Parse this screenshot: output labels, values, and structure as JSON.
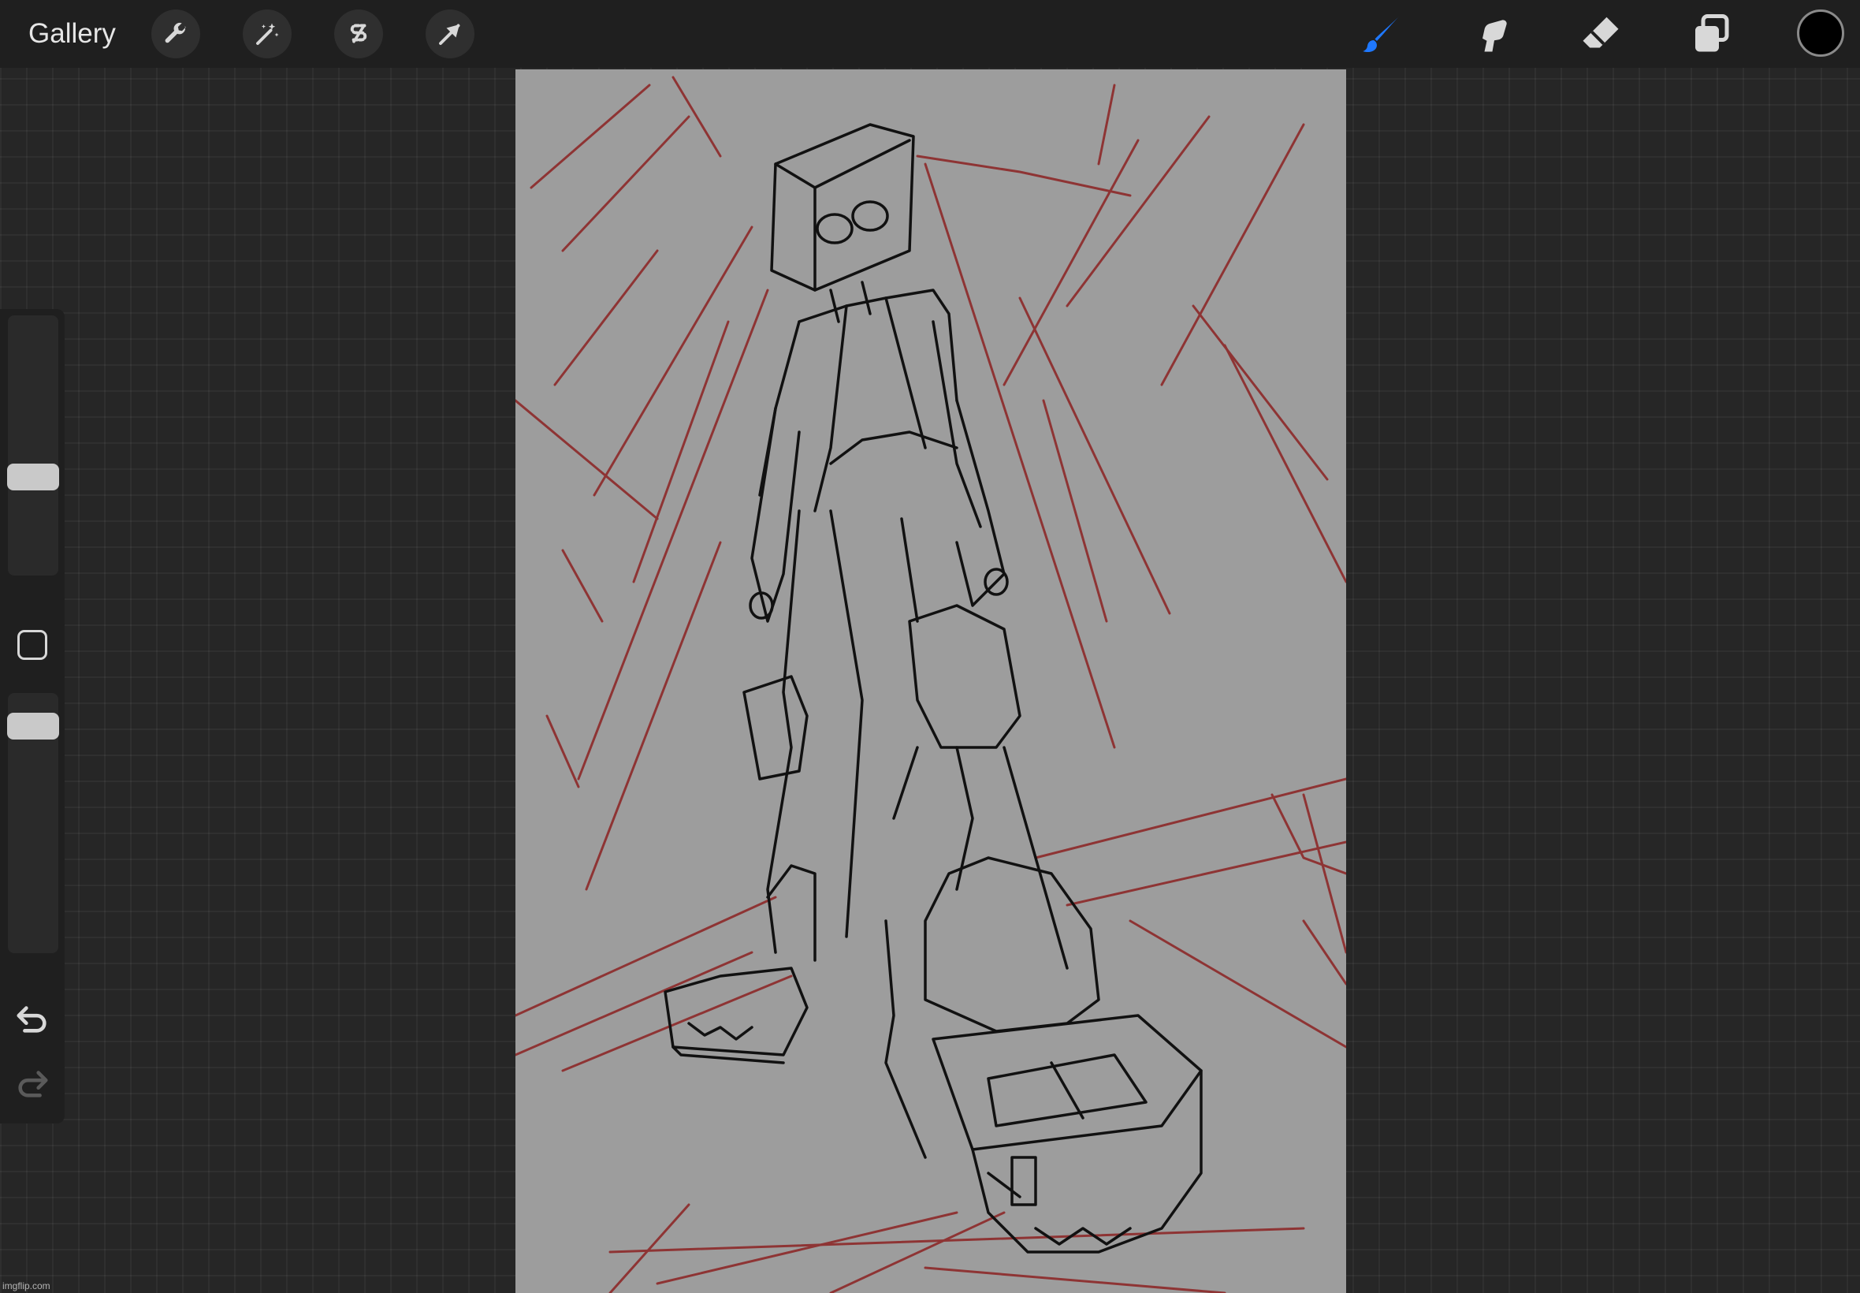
{
  "topbar": {
    "gallery_label": "Gallery",
    "left_tools": [
      "wrench-icon",
      "magic-wand-icon",
      "selection-s-icon",
      "transform-arrow-icon"
    ],
    "right_tools": [
      "brush-icon",
      "smudge-icon",
      "eraser-icon",
      "layers-icon"
    ],
    "active_tool": "brush-icon",
    "active_color": "#000000",
    "accent_color": "#1e78ff"
  },
  "sidebar": {
    "brush_size": 0.48,
    "opacity": 0.95,
    "modify_button": "square-icon",
    "undo_icon": "undo-icon",
    "redo_icon": "redo-icon"
  },
  "canvas": {
    "background_color": "#9d9d9d",
    "sketch_color": "#111111",
    "guide_color": "#8b1a1a"
  },
  "watermark": "imgflip.com"
}
